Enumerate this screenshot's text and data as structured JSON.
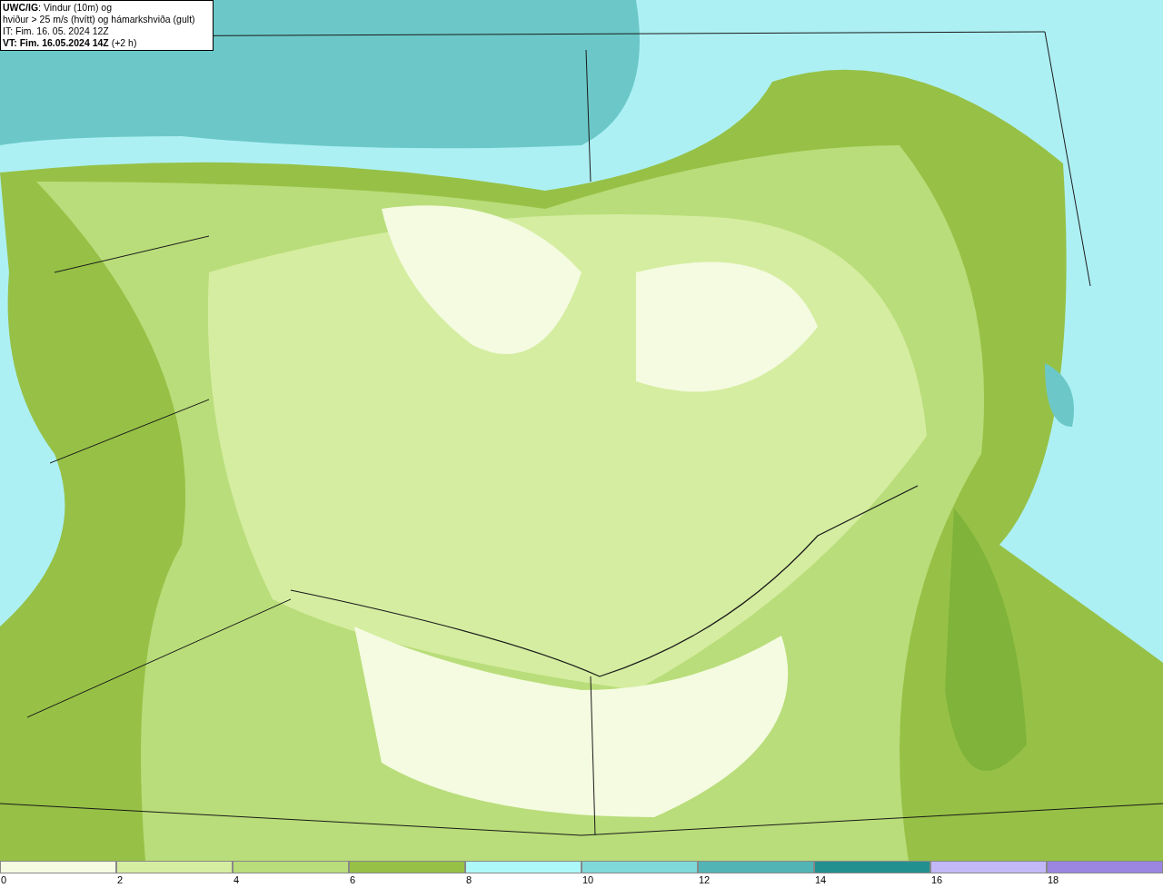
{
  "title_box": {
    "lines": [
      "**UWC/IG**: Vindur (10m) og",
      "hviður > 25 m/s (hvítt) og hámarkshviða (gult)",
      "IT: Fim. 16. 05. 2024 12Z",
      "**VT: Fim. 16.05.2024 14Z** (+2 h)"
    ]
  },
  "legend": [
    {
      "label": "0",
      "color": "#f4fbe0"
    },
    {
      "label": "2",
      "color": "#d5eda0"
    },
    {
      "label": "4",
      "color": "#b9dd7a"
    },
    {
      "label": "6",
      "color": "#96c146"
    },
    {
      "label": "8",
      "color": "#adf8f8"
    },
    {
      "label": "10",
      "color": "#80d8d8"
    },
    {
      "label": "12",
      "color": "#52b4b4"
    },
    {
      "label": "14",
      "color": "#239090"
    },
    {
      "label": "16",
      "color": "#c2b8f8"
    },
    {
      "label": "18",
      "color": "#9a86e0"
    }
  ]
}
